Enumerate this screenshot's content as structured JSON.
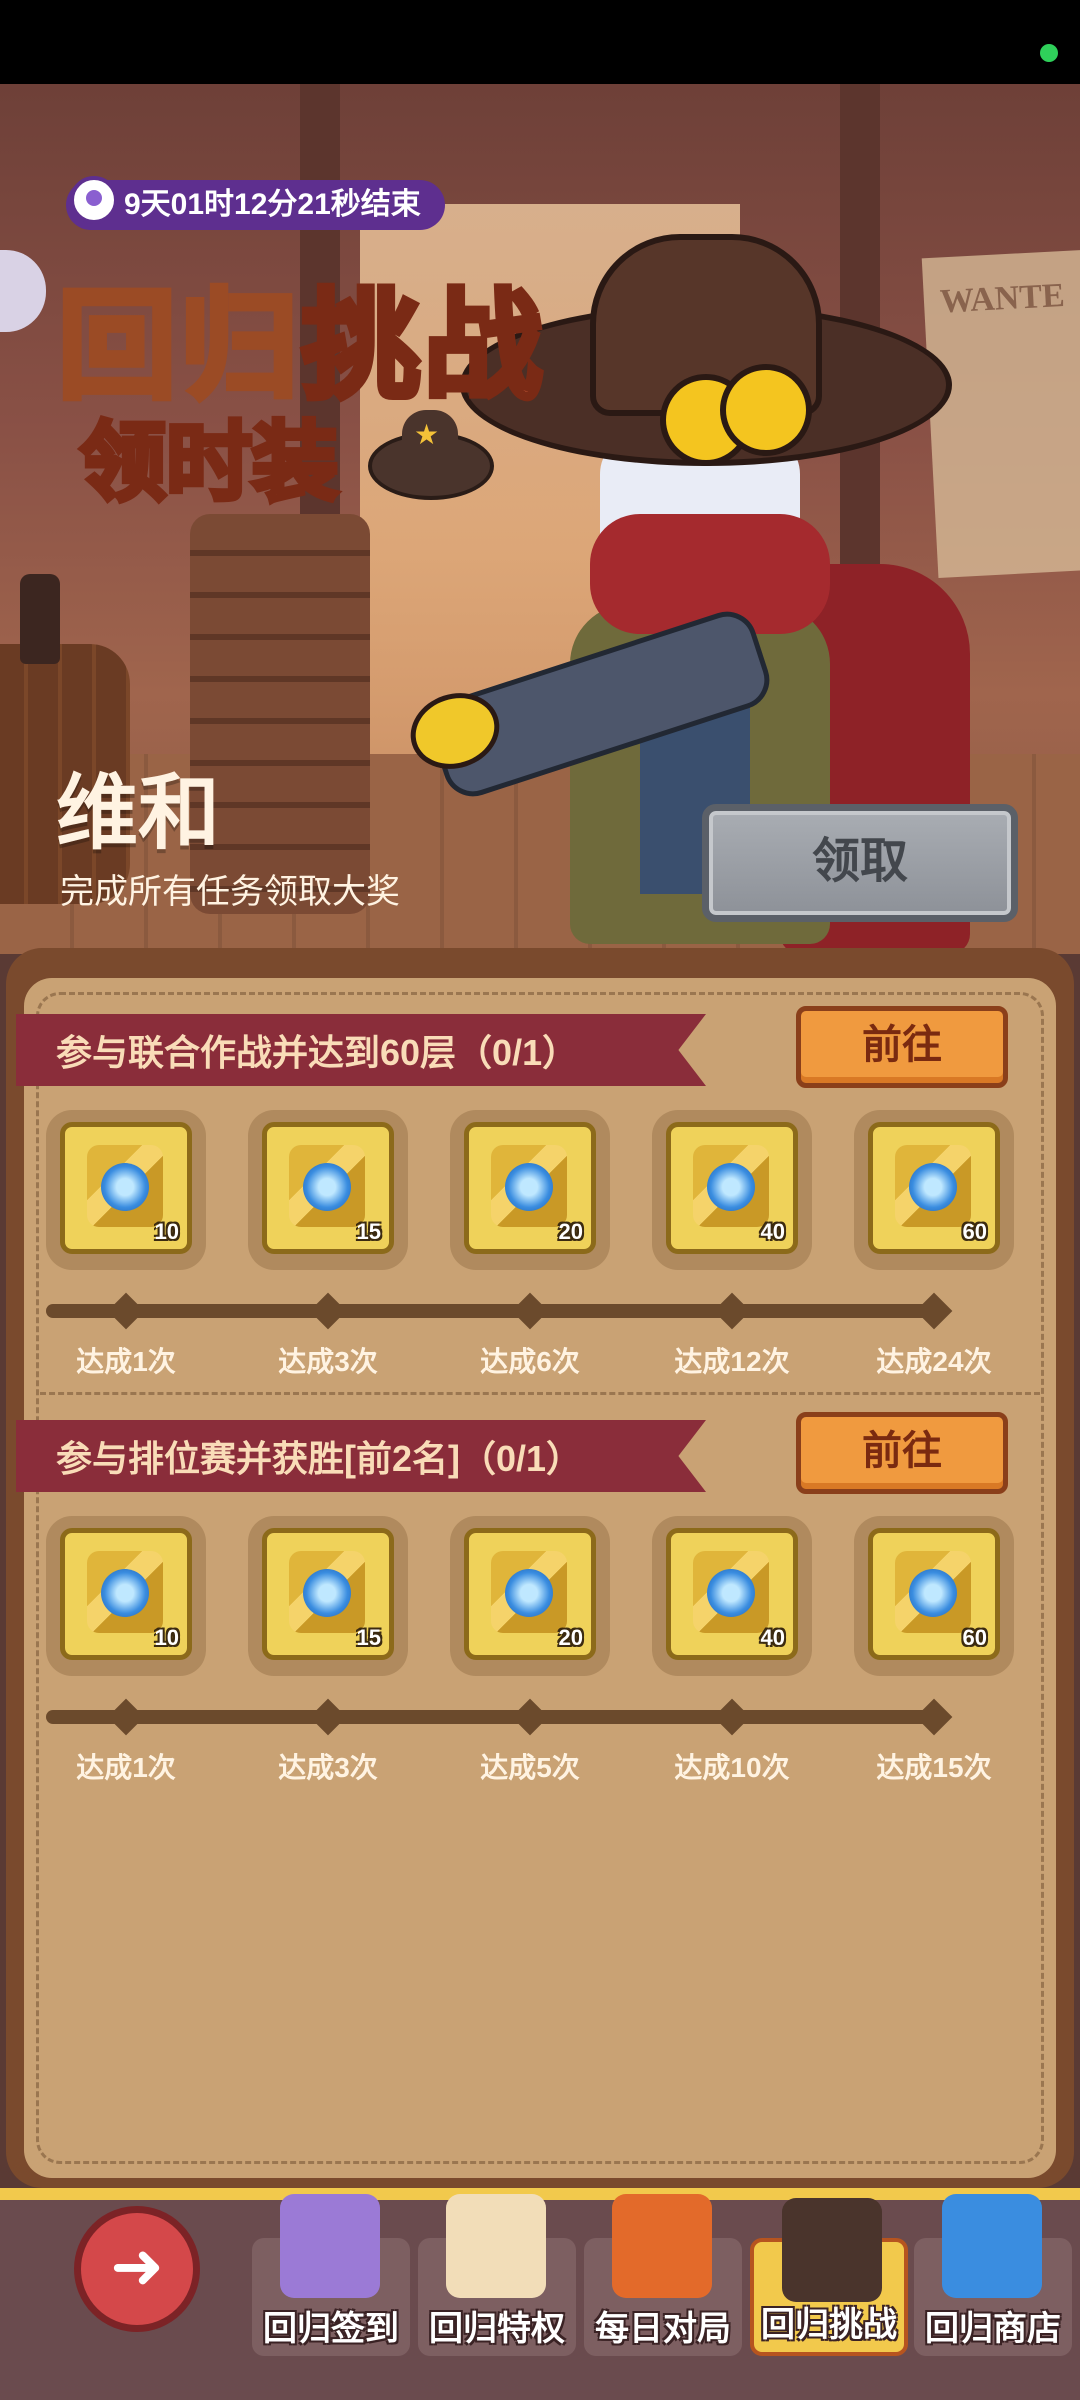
{
  "banner": {
    "timer": "9天01时12分21秒结束",
    "title_part1": "回归",
    "title_part2": "挑战",
    "subtitle": "领时装",
    "hero_name": "维和",
    "hero_desc": "完成所有任务领取大奖",
    "claim_label": "领取",
    "poster_text": "WANTE"
  },
  "tasks": [
    {
      "title": "参与联合作战并达到60层（0/1）",
      "go_label": "前往",
      "rewards": [
        "10",
        "15",
        "20",
        "40",
        "60"
      ],
      "milestones": [
        "达成1次",
        "达成3次",
        "达成6次",
        "达成12次",
        "达成24次"
      ]
    },
    {
      "title": "参与排位赛并获胜[前2名]（0/1）",
      "go_label": "前往",
      "rewards": [
        "10",
        "15",
        "20",
        "40",
        "60"
      ],
      "milestones": [
        "达成1次",
        "达成3次",
        "达成5次",
        "达成10次",
        "达成15次"
      ]
    }
  ],
  "nav": {
    "back_icon": "back-arrow-icon",
    "items": [
      {
        "label": "回归签到",
        "icon": "checkin-notebook-icon",
        "color": "#9b7ad6"
      },
      {
        "label": "回归特权",
        "icon": "privilege-chest-icon",
        "color": "#f2ddb8"
      },
      {
        "label": "每日对局",
        "icon": "crystal-icon",
        "color": "#e36a2a"
      },
      {
        "label": "回归挑战",
        "icon": "cowboy-hat-icon",
        "color": "#4a342c",
        "active": true
      },
      {
        "label": "回归商店",
        "icon": "shop-basket-icon",
        "color": "#3a8de0"
      }
    ]
  },
  "colors": {
    "accent_orange": "#f09a3f",
    "task_banner": "#8a2d3a",
    "board": "#c9a274",
    "timer_bg": "#5e2f8f"
  }
}
